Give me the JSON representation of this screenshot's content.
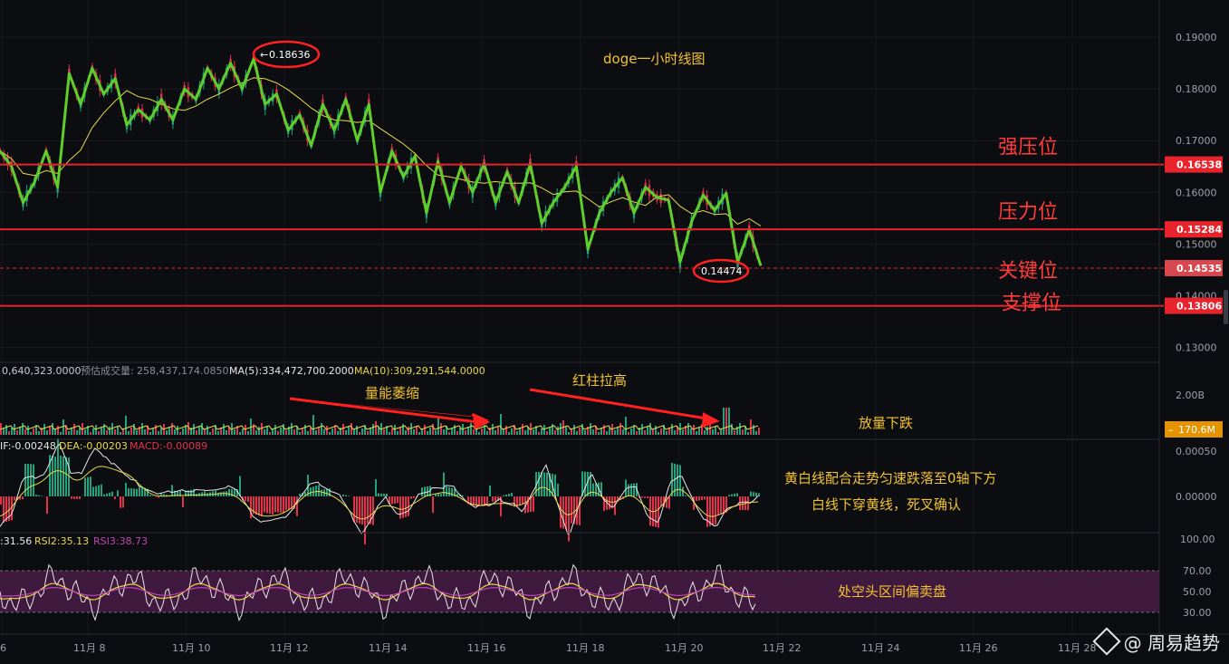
{
  "chart_data": {
    "type": "line",
    "title": "doge一小时线图",
    "price_axis": {
      "ylim": [
        0.125,
        0.195
      ],
      "ticks": [
        "0.19000",
        "0.18000",
        "0.17000",
        "0.16000",
        "0.15000",
        "0.14000",
        "0.13000"
      ]
    },
    "x_axis": {
      "ticks": [
        "6",
        "11月 8",
        "11月 10",
        "11月 12",
        "11月 14",
        "11月 16",
        "11月 18",
        "11月 20",
        "11月 22",
        "11月 24",
        "11月 26",
        "11月 28"
      ]
    },
    "series": [
      {
        "name": "price",
        "x": [
          "11月 6",
          "11月 6",
          "11月 7",
          "11月 7",
          "11月 7",
          "11月 7",
          "11月 8",
          "11月 8",
          "11月 8",
          "11月 8",
          "11月 8",
          "11月 9",
          "11月 9",
          "11月 9",
          "11月 9",
          "11月 9",
          "11月 10",
          "11月 10",
          "11月 10",
          "11月 10",
          "11月 10",
          "11月 11",
          "11月 11",
          "11月 11",
          "11月 11",
          "11月 11",
          "11月 12",
          "11月 12",
          "11月 12",
          "11月 12",
          "11月 13",
          "11月 13",
          "11月 13",
          "11月 13",
          "11月 14",
          "11月 14",
          "11月 14",
          "11月 14",
          "11月 15",
          "11月 15",
          "11月 15",
          "11月 15",
          "11月 15",
          "11月 16",
          "11月 16",
          "11月 16",
          "11月 16",
          "11月 17",
          "11月 17",
          "11月 17",
          "11月 17",
          "11月 18",
          "11月 18",
          "11月 18",
          "11月 18",
          "11月 19",
          "11月 19",
          "11月 19",
          "11月 19",
          "11月 20",
          "11月 20",
          "11月 20",
          "11月 20",
          "11月 20",
          "11月 21",
          "11月 21",
          "11月 21"
        ],
        "values": [
          0.168,
          0.165,
          0.158,
          0.162,
          0.168,
          0.161,
          0.183,
          0.177,
          0.184,
          0.179,
          0.182,
          0.173,
          0.176,
          0.174,
          0.178,
          0.174,
          0.18,
          0.178,
          0.184,
          0.18,
          0.185,
          0.18,
          0.1858,
          0.177,
          0.179,
          0.172,
          0.175,
          0.169,
          0.177,
          0.172,
          0.178,
          0.17,
          0.177,
          0.16,
          0.168,
          0.163,
          0.167,
          0.156,
          0.166,
          0.158,
          0.165,
          0.16,
          0.1655,
          0.158,
          0.164,
          0.158,
          0.1655,
          0.154,
          0.158,
          0.161,
          0.165,
          0.149,
          0.156,
          0.16,
          0.1628,
          0.156,
          0.161,
          0.159,
          0.1585,
          0.1465,
          0.1543,
          0.1595,
          0.1565,
          0.1598,
          0.1465,
          0.1528,
          0.1458
        ]
      }
    ],
    "reference_lines": [
      {
        "label": "强压位",
        "value": "0.16538",
        "color": "#e8232b"
      },
      {
        "label": "压力位",
        "value": "0.15284",
        "color": "#e8232b"
      },
      {
        "label": "关键位",
        "value": "0.14535",
        "color": "#e8232b"
      },
      {
        "label": "支撑位",
        "value": "0.13806",
        "color": "#e8232b"
      }
    ],
    "high_marker": "0.18636",
    "low_marker": "0.14474",
    "volume": {
      "legend_vol": "0,640,323.0000",
      "legend_est_label": "预估成交量:",
      "legend_est": "258,437,174.0850",
      "legend_ma5": "MA(5):334,472,700.2000",
      "legend_ma10": "MA(10):309,291,544.0000",
      "axis_top": "2.00B",
      "current": "170.6M",
      "notes": [
        "量能萎缩",
        "红柱拉高",
        "放量下跌"
      ]
    },
    "macd": {
      "legend_dif": "IF:-0.00248",
      "legend_dea": "DEA:-0.00203",
      "legend_macd": "MACD:-0.00089",
      "ticks": [
        "0.00050",
        "0.00000"
      ],
      "notes": [
        "黄白线配合走势匀速跌落至0轴下方",
        "白线下穿黄线，死叉确认"
      ]
    },
    "rsi": {
      "legend_rsi1": ":31.56",
      "legend_rsi2": "RSI2:35.13",
      "legend_rsi3": "RSI3:38.73",
      "ticks": [
        "100.00",
        "70.00",
        "50.00",
        "30.00"
      ],
      "note": "处空头区间偏卖盘"
    }
  },
  "watermark": "@ 周易趋势",
  "colors": {
    "price_line": "#5fce2c",
    "candle_up": "#1fa37d",
    "candle_down": "#e0334b",
    "ma_yellow": "#e9d84c",
    "level_red": "#e8232b",
    "rsi_band": "#4a1c48"
  }
}
